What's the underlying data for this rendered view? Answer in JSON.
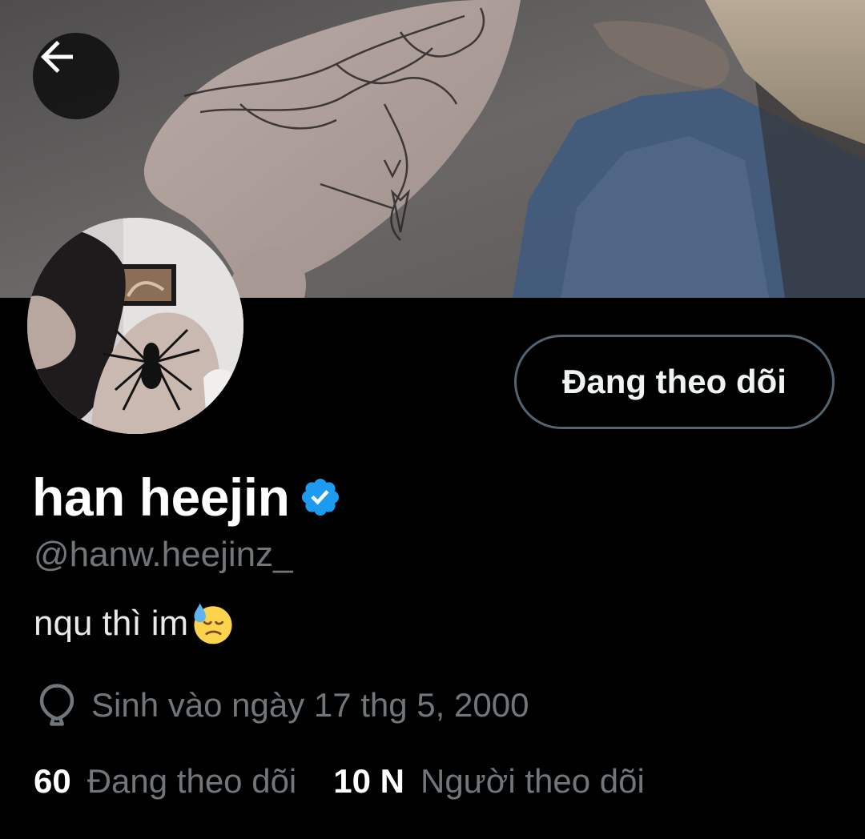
{
  "profile": {
    "display_name": "han heejin",
    "handle": "@hanw.heejinz_",
    "bio": "nqu thì im",
    "bio_emoji": "downcast-face-with-sweat",
    "verified": true,
    "birthday": "Sinh vào ngày 17 thg 5, 2000"
  },
  "actions": {
    "back_icon": "arrow-left-icon",
    "follow_label": "Đang theo dõi"
  },
  "stats": {
    "following_count": "60",
    "following_label": "Đang theo dõi",
    "followers_count": "10 N",
    "followers_label": "Người theo dõi"
  },
  "colors": {
    "background": "#000000",
    "primary_text": "#e7e9ea",
    "secondary_text": "#71767b",
    "verified_blue": "#1d9bf0",
    "button_border": "#536471"
  }
}
